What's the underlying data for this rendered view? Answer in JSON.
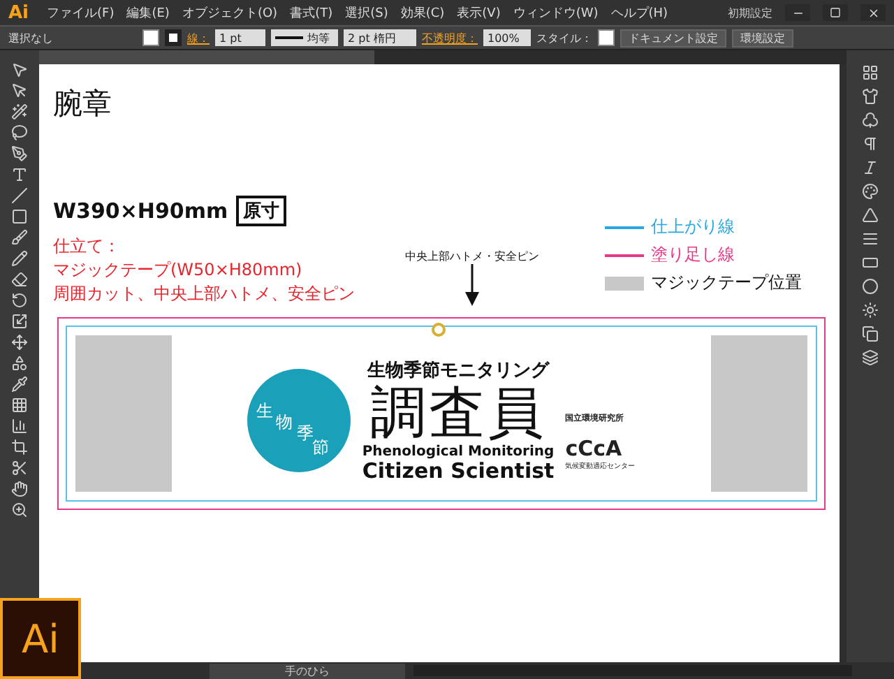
{
  "app": {
    "logo": "Ai",
    "workspace": "初期設定"
  },
  "menu": [
    "ファイル(F)",
    "編集(E)",
    "オブジェクト(O)",
    "書式(T)",
    "選択(S)",
    "効果(C)",
    "表示(V)",
    "ウィンドウ(W)",
    "ヘルプ(H)"
  ],
  "control_bar": {
    "selection": "選択なし",
    "stroke_label": "線：",
    "stroke_weight": "1 pt",
    "stroke_style": "均等",
    "brush": "2 pt 楕円",
    "opacity_label": "不透明度：",
    "opacity": "100%",
    "style_label": "スタイル：",
    "buttons": [
      "ドキュメント設定",
      "環境設定"
    ]
  },
  "artboard": {
    "title": "腕章",
    "size": "W390×H90mm",
    "size_badge": "原寸",
    "notes": [
      "仕立て：",
      "マジックテープ(W50×H80mm)",
      "周囲カット、中央上部ハトメ、安全ピン"
    ],
    "pointer_label": "中央上部ハトメ・安全ピン",
    "legend": [
      {
        "kind": "line",
        "label": "仕上がり線",
        "color": "#29a8e0"
      },
      {
        "kind": "line",
        "label": "塗り足し線",
        "color": "#e8388a"
      },
      {
        "kind": "swatch",
        "label": "マジックテープ位置",
        "color": "#c8c8c8"
      }
    ],
    "armband": {
      "logo_text": "生物季節",
      "subtitle": "生物季節モニタリング",
      "title": "調査員",
      "english_1": "Phenological Monitoring",
      "english_2": "Citizen Scientist",
      "partner_1": "国立環境研究所",
      "partner_2": "cCcA",
      "partner_2_caption": "気候変動適応センター"
    }
  },
  "status_bar": {
    "tool": "手のひら"
  },
  "app_icon": {
    "label": "Ai"
  }
}
